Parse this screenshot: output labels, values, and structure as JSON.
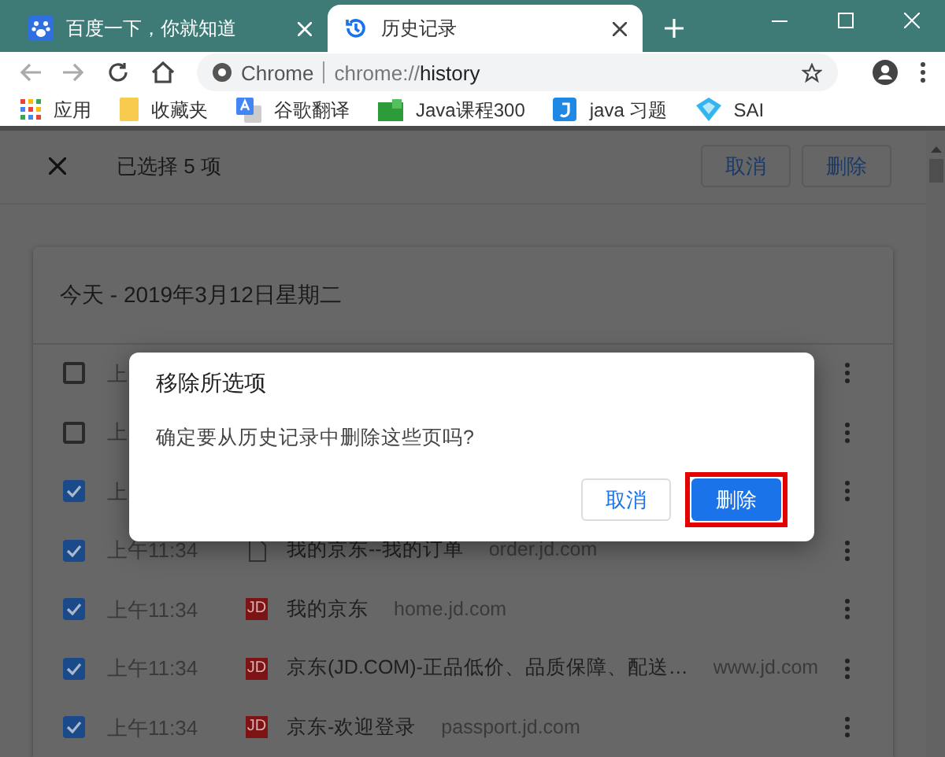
{
  "tabs": [
    {
      "title": "百度一下，你就知道",
      "kind": "paw",
      "selected": false
    },
    {
      "title": "历史记录",
      "kind": "history",
      "selected": true
    }
  ],
  "address_bar": {
    "scheme_label": "Chrome",
    "url_prefix": "chrome://",
    "url_host": "history"
  },
  "bookmarks": [
    {
      "label": "应用",
      "kind": "apps"
    },
    {
      "label": "收藏夹",
      "kind": "folder"
    },
    {
      "label": "谷歌翻译",
      "kind": "translate"
    },
    {
      "label": "Java课程300",
      "kind": "green"
    },
    {
      "label": "java 习题",
      "kind": "j"
    },
    {
      "label": "SAI",
      "kind": "diamond"
    }
  ],
  "selection_bar": {
    "title": "已选择 5 项",
    "buttons": [
      "取消",
      "删除"
    ]
  },
  "history": {
    "date_heading": "今天 - 2019年3月12日星期二",
    "rows": [
      {
        "kind": "covered",
        "checked": false,
        "time": "上"
      },
      {
        "kind": "covered",
        "checked": false,
        "time": "上"
      },
      {
        "kind": "covered",
        "checked": true,
        "time": "上"
      },
      {
        "kind": "page",
        "checked": true,
        "time": "上午11:34",
        "title": "我的京东--我的订单",
        "domain": "order.jd.com"
      },
      {
        "kind": "jd",
        "checked": true,
        "time": "上午11:34",
        "favicon_text": "JD",
        "title": "我的京东",
        "domain": "home.jd.com"
      },
      {
        "kind": "jd",
        "checked": true,
        "time": "上午11:34",
        "favicon_text": "JD",
        "title": "京东(JD.COM)-正品低价、品质保障、配送…",
        "domain": "www.jd.com"
      },
      {
        "kind": "jd",
        "checked": true,
        "time": "上午11:34",
        "favicon_text": "JD",
        "title": "京东-欢迎登录",
        "domain": "passport.jd.com"
      }
    ]
  },
  "dialog": {
    "title": "移除所选项",
    "message": "确定要从历史记录中删除这些页吗?",
    "buttons": [
      {
        "label": "取消",
        "kind": "secondary",
        "highlighted": false
      },
      {
        "label": "删除",
        "kind": "primary",
        "highlighted": true
      }
    ]
  }
}
